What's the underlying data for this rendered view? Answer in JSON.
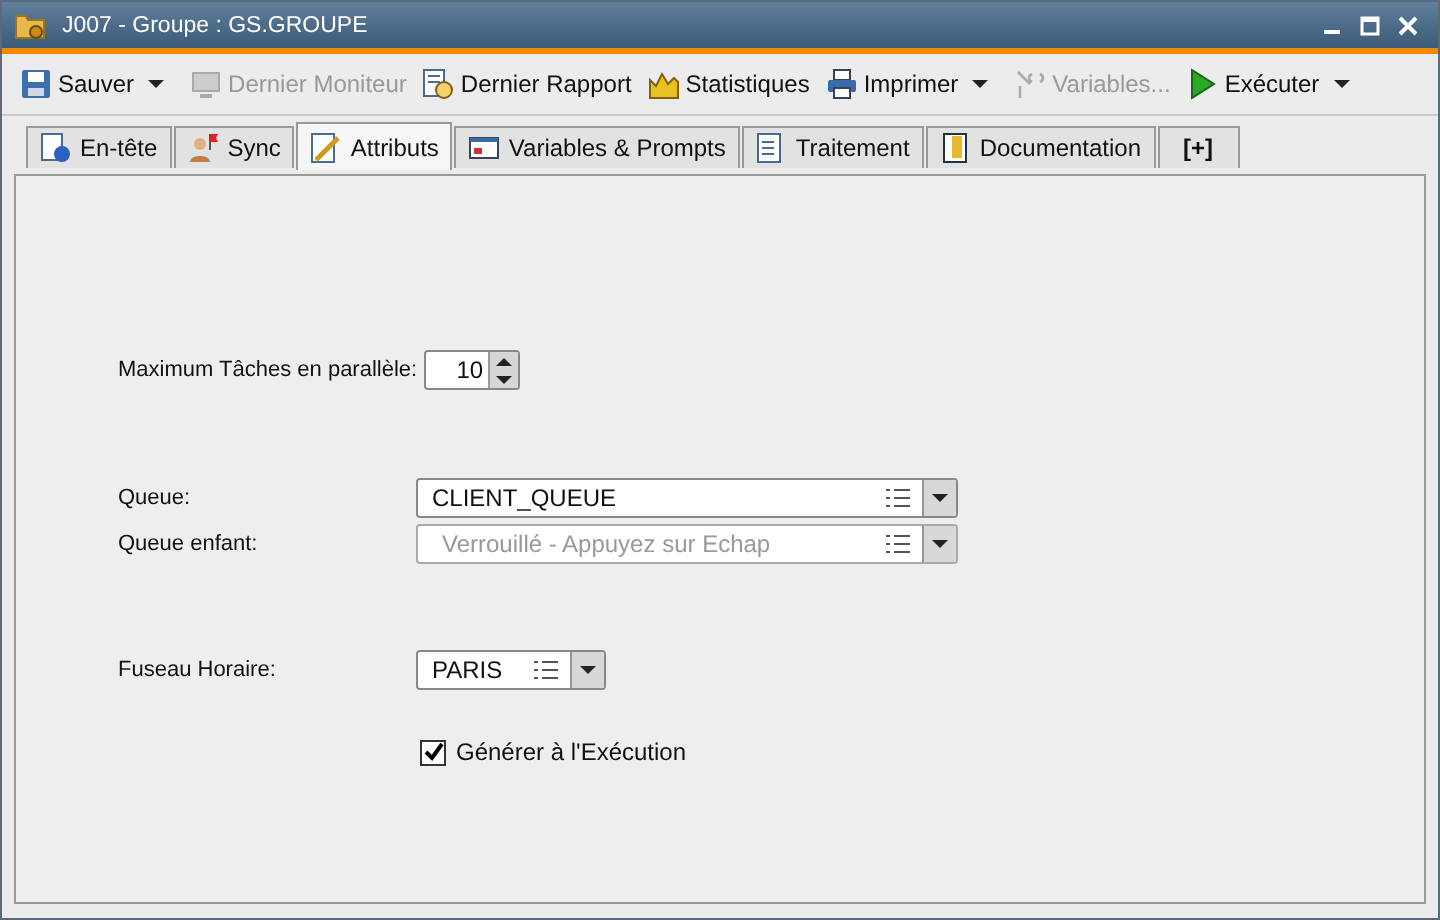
{
  "window": {
    "title": "J007 - Groupe : GS.GROUPE"
  },
  "toolbar": [
    {
      "label": "Sauver",
      "disabled": false,
      "dropdown": true
    },
    {
      "label": "Dernier Moniteur",
      "disabled": true,
      "dropdown": false
    },
    {
      "label": "Dernier Rapport",
      "disabled": false,
      "dropdown": false
    },
    {
      "label": "Statistiques",
      "disabled": false,
      "dropdown": false
    },
    {
      "label": "Imprimer",
      "disabled": false,
      "dropdown": true
    },
    {
      "label": "Variables...",
      "disabled": true,
      "dropdown": false
    },
    {
      "label": "Exécuter",
      "disabled": false,
      "dropdown": true
    }
  ],
  "tabs": [
    {
      "label": "En-tête",
      "selected": false
    },
    {
      "label": "Sync",
      "selected": false
    },
    {
      "label": "Attributs",
      "selected": true
    },
    {
      "label": "Variables & Prompts",
      "selected": false
    },
    {
      "label": "Traitement",
      "selected": false
    },
    {
      "label": "Documentation",
      "selected": false
    },
    {
      "label": "[+]",
      "selected": false
    }
  ],
  "form": [
    {
      "kind": "spinner",
      "label": "Maximum Tâches en parallèle:",
      "value": "10"
    },
    {
      "kind": "combo",
      "label": "Queue:",
      "value": "CLIENT_QUEUE",
      "disabled": false
    },
    {
      "kind": "combo",
      "label": "Queue enfant:",
      "placeholder": "Verrouillé - Appuyez sur Echap",
      "disabled": true
    },
    {
      "kind": "combo",
      "label": "Fuseau Horaire:",
      "value": "PARIS",
      "disabled": false
    },
    {
      "kind": "checkbox",
      "label": "Générer à l'Exécution",
      "checked": true
    }
  ]
}
